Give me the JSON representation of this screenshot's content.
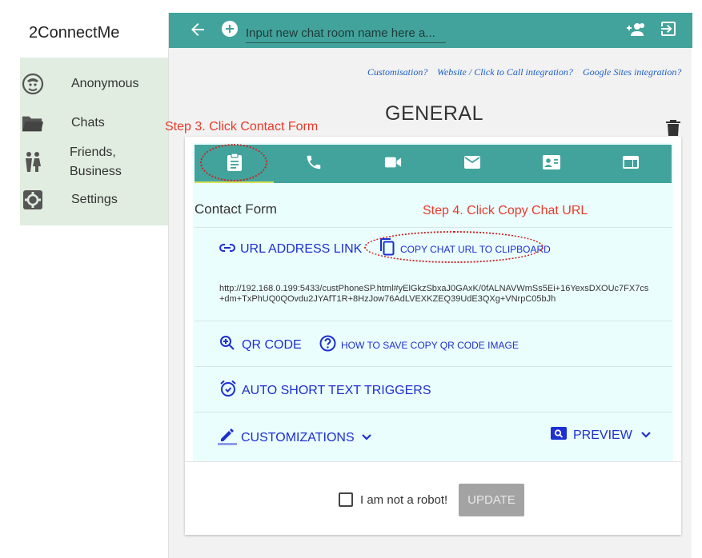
{
  "app": {
    "brand": "2ConnectMe"
  },
  "sidebar": {
    "items": [
      {
        "label": "Anonymous",
        "icon": "anonymous-icon"
      },
      {
        "label": "Chats",
        "icon": "folder-icon"
      },
      {
        "label": "Friends,",
        "label2": "Business",
        "icon": "people-icon"
      },
      {
        "label": "Settings",
        "icon": "gear-icon"
      }
    ]
  },
  "topbar": {
    "placeholder": "Input new chat room name here a...",
    "icons": [
      "back-arrow-icon",
      "add-circle-icon",
      "add-person-icon",
      "exit-icon"
    ]
  },
  "links": {
    "customisation": "Customisation?",
    "website": "Website / Click to Call integration?",
    "sites": "Google Sites integration?"
  },
  "room": {
    "title": "GENERAL"
  },
  "tabs": [
    {
      "name": "contact-form",
      "icon": "clipboard-icon"
    },
    {
      "name": "phone",
      "icon": "phone-icon"
    },
    {
      "name": "video",
      "icon": "video-icon"
    },
    {
      "name": "email",
      "icon": "email-icon"
    },
    {
      "name": "contact-card",
      "icon": "contact-card-icon"
    },
    {
      "name": "web",
      "icon": "web-icon"
    }
  ],
  "contact_form": {
    "title": "Contact Form",
    "url_label": "URL ADDRESS LINK",
    "copy_label": "COPY CHAT URL TO CLIPBOARD",
    "url": "http://192.168.0.199:5433/custPhoneSP.html#yElGkzSbxaJ0GAxK/0fALNAVWmSs5Ei+16YexsDXOUc7FX7cs+dm+TxPhUQ0QOvdu2JYAfT1R+8HzJow76AdLVEXKZEQ39UdE3QXg+VNrpC05bJh",
    "qr_label": "QR CODE",
    "qr_help": "HOW TO SAVE COPY QR CODE IMAGE",
    "triggers_label": "AUTO SHORT TEXT TRIGGERS",
    "custom_label": "CUSTOMIZATIONS",
    "preview_label": "PREVIEW"
  },
  "footer": {
    "robot_label": "I am not a robot!",
    "update_label": "UPDATE"
  },
  "annotations": {
    "step3": "Step 3. Click Contact Form",
    "step4": "Step 4. Click Copy Chat URL"
  },
  "colors": {
    "teal": "#42a39c",
    "sidebar_bg": "#e0ede0",
    "link_blue": "#1c2fd0",
    "annotation_red": "#e83a2a"
  }
}
